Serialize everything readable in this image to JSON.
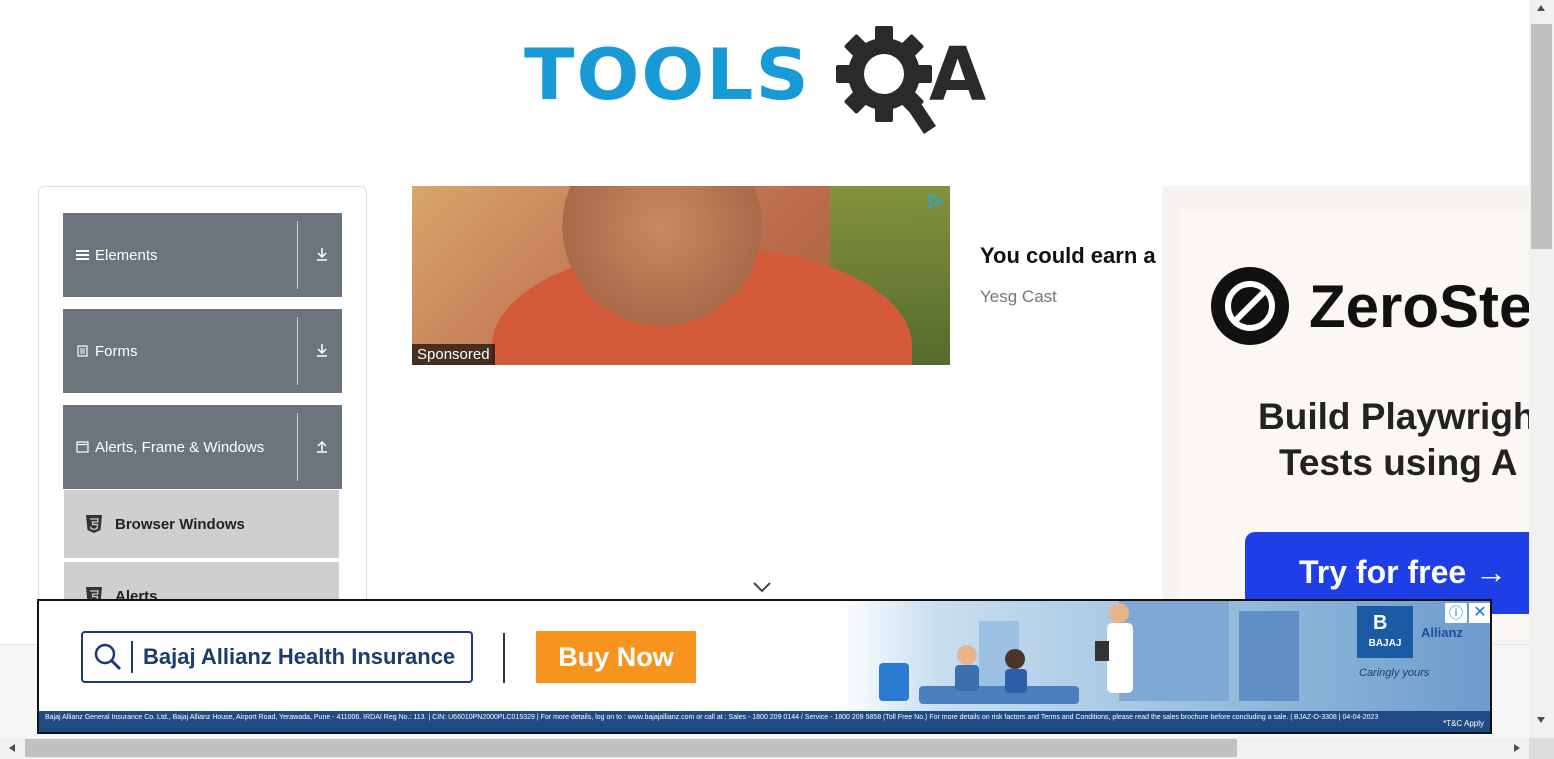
{
  "logo": {
    "tools": "TOOLS",
    "a": "A",
    "colors": {
      "tools": "#189ad7",
      "qa": "#2a2a2a"
    }
  },
  "sidebar": {
    "groups": [
      {
        "label": "Elements",
        "icon": "hamburger-icon",
        "arrow": "↓"
      },
      {
        "label": "Forms",
        "icon": "document-icon",
        "arrow": "↓"
      },
      {
        "label": "Alerts, Frame & Windows",
        "icon": "window-icon",
        "arrow": "↑"
      }
    ],
    "items": [
      {
        "label": "Browser Windows",
        "icon": "html5-icon"
      },
      {
        "label": "Alerts",
        "icon": "html5-icon"
      }
    ],
    "header_color": "#6c747d",
    "item_color": "#cfcfcf"
  },
  "sponsored_ad": {
    "tag": "Sponsored",
    "headline": "You could earn a",
    "source": "Yesg Cast"
  },
  "right_ad": {
    "brand": "ZeroSte",
    "line1": "Build Playwrigh",
    "line2": "Tests using A",
    "cta": "Try for free →",
    "cta_color": "#1f3fe6"
  },
  "banner_ad": {
    "search_text": "Bajaj Allianz Health Insurance",
    "buy_label": "Buy Now",
    "brand": "BAJAJ",
    "brand_mark": "B",
    "allianz": "Allianz",
    "tagline": "Caringly yours",
    "disclaimer": "Bajaj Allianz General Insurance Co. Ltd., Bajaj Allianz House, Airport Road, Yerawada, Pune - 411006. IRDAI Reg No.: 113. | CIN: U66010PN2000PLC015329 | For more details, log on to : www.bajajallianz.com or call at : Sales - 1800 209 0144 / Service - 1800 209 5858 (Toll Free No.) For more details on risk factors and Terms and Conditions, please read the sales brochure before concluding a sale. | BJAZ-O-3308 | 04-04-2023",
    "tnc": "*T&C Apply",
    "info": "ⓘ",
    "close": "✕",
    "accent": "#f7941d"
  }
}
